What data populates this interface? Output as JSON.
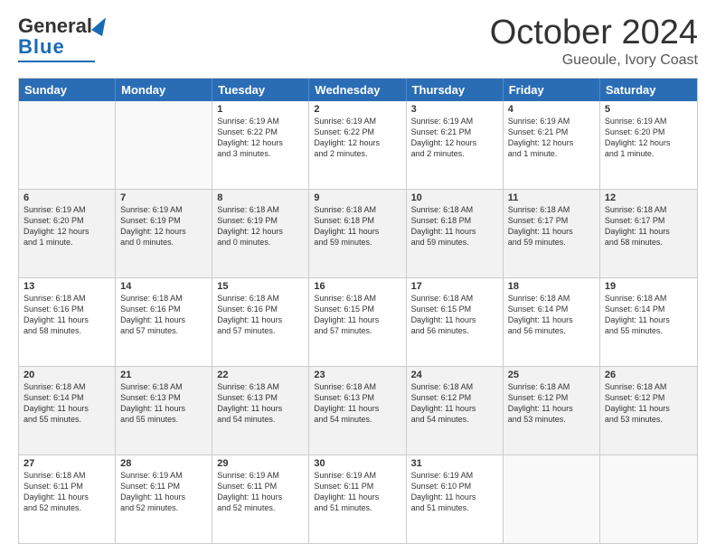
{
  "logo": {
    "line1": "General",
    "line2": "Blue"
  },
  "title": "October 2024",
  "subtitle": "Gueoule, Ivory Coast",
  "days": [
    "Sunday",
    "Monday",
    "Tuesday",
    "Wednesday",
    "Thursday",
    "Friday",
    "Saturday"
  ],
  "rows": [
    [
      {
        "day": "",
        "info": ""
      },
      {
        "day": "",
        "info": ""
      },
      {
        "day": "1",
        "info": "Sunrise: 6:19 AM\nSunset: 6:22 PM\nDaylight: 12 hours\nand 3 minutes."
      },
      {
        "day": "2",
        "info": "Sunrise: 6:19 AM\nSunset: 6:22 PM\nDaylight: 12 hours\nand 2 minutes."
      },
      {
        "day": "3",
        "info": "Sunrise: 6:19 AM\nSunset: 6:21 PM\nDaylight: 12 hours\nand 2 minutes."
      },
      {
        "day": "4",
        "info": "Sunrise: 6:19 AM\nSunset: 6:21 PM\nDaylight: 12 hours\nand 1 minute."
      },
      {
        "day": "5",
        "info": "Sunrise: 6:19 AM\nSunset: 6:20 PM\nDaylight: 12 hours\nand 1 minute."
      }
    ],
    [
      {
        "day": "6",
        "info": "Sunrise: 6:19 AM\nSunset: 6:20 PM\nDaylight: 12 hours\nand 1 minute."
      },
      {
        "day": "7",
        "info": "Sunrise: 6:19 AM\nSunset: 6:19 PM\nDaylight: 12 hours\nand 0 minutes."
      },
      {
        "day": "8",
        "info": "Sunrise: 6:18 AM\nSunset: 6:19 PM\nDaylight: 12 hours\nand 0 minutes."
      },
      {
        "day": "9",
        "info": "Sunrise: 6:18 AM\nSunset: 6:18 PM\nDaylight: 11 hours\nand 59 minutes."
      },
      {
        "day": "10",
        "info": "Sunrise: 6:18 AM\nSunset: 6:18 PM\nDaylight: 11 hours\nand 59 minutes."
      },
      {
        "day": "11",
        "info": "Sunrise: 6:18 AM\nSunset: 6:17 PM\nDaylight: 11 hours\nand 59 minutes."
      },
      {
        "day": "12",
        "info": "Sunrise: 6:18 AM\nSunset: 6:17 PM\nDaylight: 11 hours\nand 58 minutes."
      }
    ],
    [
      {
        "day": "13",
        "info": "Sunrise: 6:18 AM\nSunset: 6:16 PM\nDaylight: 11 hours\nand 58 minutes."
      },
      {
        "day": "14",
        "info": "Sunrise: 6:18 AM\nSunset: 6:16 PM\nDaylight: 11 hours\nand 57 minutes."
      },
      {
        "day": "15",
        "info": "Sunrise: 6:18 AM\nSunset: 6:16 PM\nDaylight: 11 hours\nand 57 minutes."
      },
      {
        "day": "16",
        "info": "Sunrise: 6:18 AM\nSunset: 6:15 PM\nDaylight: 11 hours\nand 57 minutes."
      },
      {
        "day": "17",
        "info": "Sunrise: 6:18 AM\nSunset: 6:15 PM\nDaylight: 11 hours\nand 56 minutes."
      },
      {
        "day": "18",
        "info": "Sunrise: 6:18 AM\nSunset: 6:14 PM\nDaylight: 11 hours\nand 56 minutes."
      },
      {
        "day": "19",
        "info": "Sunrise: 6:18 AM\nSunset: 6:14 PM\nDaylight: 11 hours\nand 55 minutes."
      }
    ],
    [
      {
        "day": "20",
        "info": "Sunrise: 6:18 AM\nSunset: 6:14 PM\nDaylight: 11 hours\nand 55 minutes."
      },
      {
        "day": "21",
        "info": "Sunrise: 6:18 AM\nSunset: 6:13 PM\nDaylight: 11 hours\nand 55 minutes."
      },
      {
        "day": "22",
        "info": "Sunrise: 6:18 AM\nSunset: 6:13 PM\nDaylight: 11 hours\nand 54 minutes."
      },
      {
        "day": "23",
        "info": "Sunrise: 6:18 AM\nSunset: 6:13 PM\nDaylight: 11 hours\nand 54 minutes."
      },
      {
        "day": "24",
        "info": "Sunrise: 6:18 AM\nSunset: 6:12 PM\nDaylight: 11 hours\nand 54 minutes."
      },
      {
        "day": "25",
        "info": "Sunrise: 6:18 AM\nSunset: 6:12 PM\nDaylight: 11 hours\nand 53 minutes."
      },
      {
        "day": "26",
        "info": "Sunrise: 6:18 AM\nSunset: 6:12 PM\nDaylight: 11 hours\nand 53 minutes."
      }
    ],
    [
      {
        "day": "27",
        "info": "Sunrise: 6:18 AM\nSunset: 6:11 PM\nDaylight: 11 hours\nand 52 minutes."
      },
      {
        "day": "28",
        "info": "Sunrise: 6:19 AM\nSunset: 6:11 PM\nDaylight: 11 hours\nand 52 minutes."
      },
      {
        "day": "29",
        "info": "Sunrise: 6:19 AM\nSunset: 6:11 PM\nDaylight: 11 hours\nand 52 minutes."
      },
      {
        "day": "30",
        "info": "Sunrise: 6:19 AM\nSunset: 6:11 PM\nDaylight: 11 hours\nand 51 minutes."
      },
      {
        "day": "31",
        "info": "Sunrise: 6:19 AM\nSunset: 6:10 PM\nDaylight: 11 hours\nand 51 minutes."
      },
      {
        "day": "",
        "info": ""
      },
      {
        "day": "",
        "info": ""
      }
    ]
  ]
}
